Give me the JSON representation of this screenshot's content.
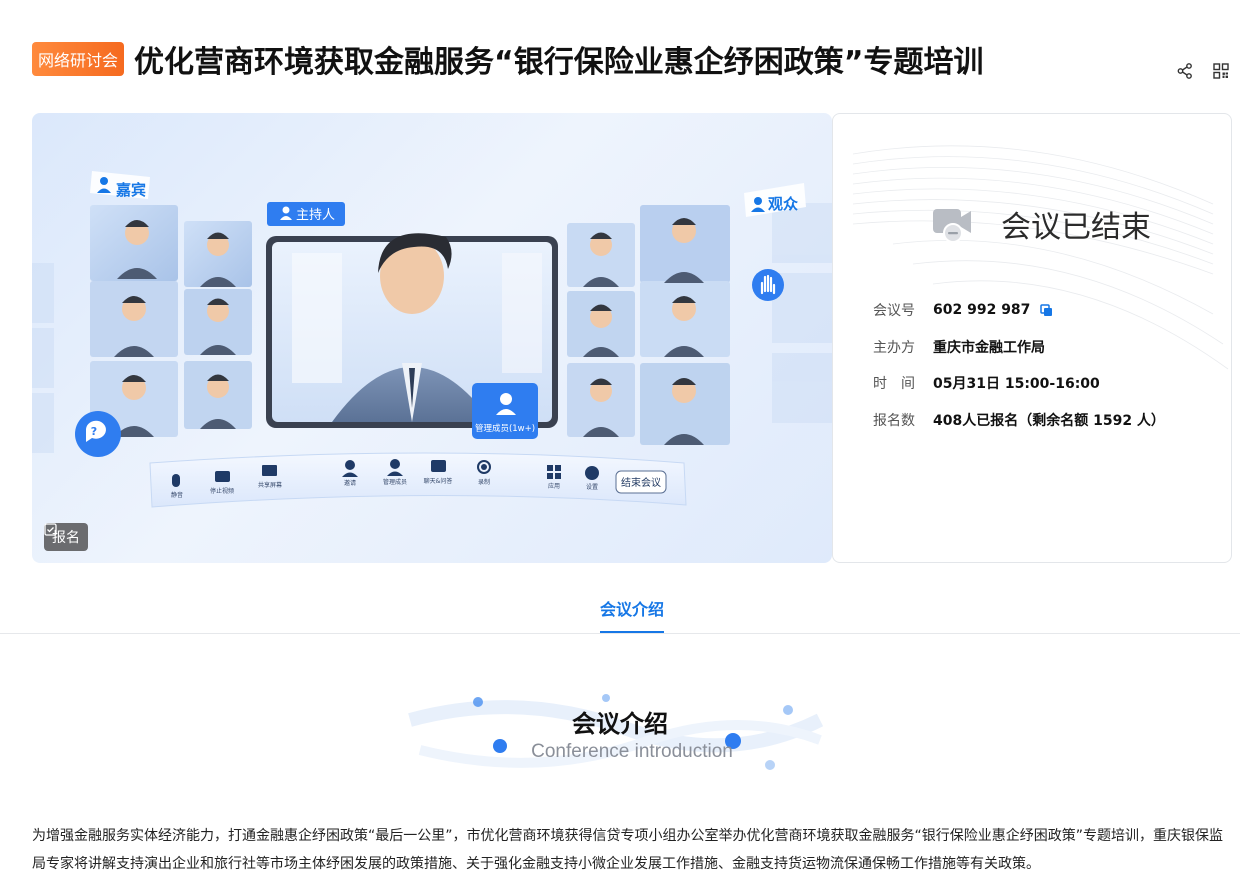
{
  "header": {
    "badge": "网络研讨会",
    "title": "优化营商环境获取金融服务“银行保险业惠企纾困政策”专题培训",
    "icons": [
      "share-icon",
      "qrcode-icon"
    ]
  },
  "banner": {
    "guest_label": "嘉宾",
    "host_label": "主持人",
    "audience_label": "观众",
    "manage_label": "管理成员(1w+)",
    "signup_label": "报名",
    "toolbar": {
      "items": [
        "静音",
        "停止视频",
        "共享屏幕",
        "邀请",
        "管理成员",
        "聊天&问答",
        "录制",
        "应用",
        "设置"
      ],
      "end_label": "结束会议"
    },
    "colors": {
      "accent": "#1677e6",
      "light": "#dbe8fb"
    }
  },
  "info": {
    "status": "会议已结束",
    "rows": [
      {
        "key": "会议号",
        "value": "602 992 987"
      },
      {
        "key": "主办方",
        "value": "重庆市金融工作局"
      },
      {
        "key": "时　间",
        "value": "05月31日 15:00-16:00"
      },
      {
        "key": "报名数",
        "value": "408人已报名（剩余名额 1592 人）"
      }
    ]
  },
  "tabs": {
    "active": "会议介绍"
  },
  "section": {
    "title": "会议介绍",
    "subtitle": "Conference introduction",
    "description": "为增强金融服务实体经济能力，打通金融惠企纾困政策“最后一公里”，市优化营商环境获得信贷专项小组办公室举办优化营商环境获取金融服务“银行保险业惠企纾困政策”专题培训，重庆银保监局专家将讲解支持演出企业和旅行社等市场主体纾困发展的政策措施、关于强化金融支持小微企业发展工作措施、金融支持货运物流保通保畅工作措施等有关政策。"
  }
}
